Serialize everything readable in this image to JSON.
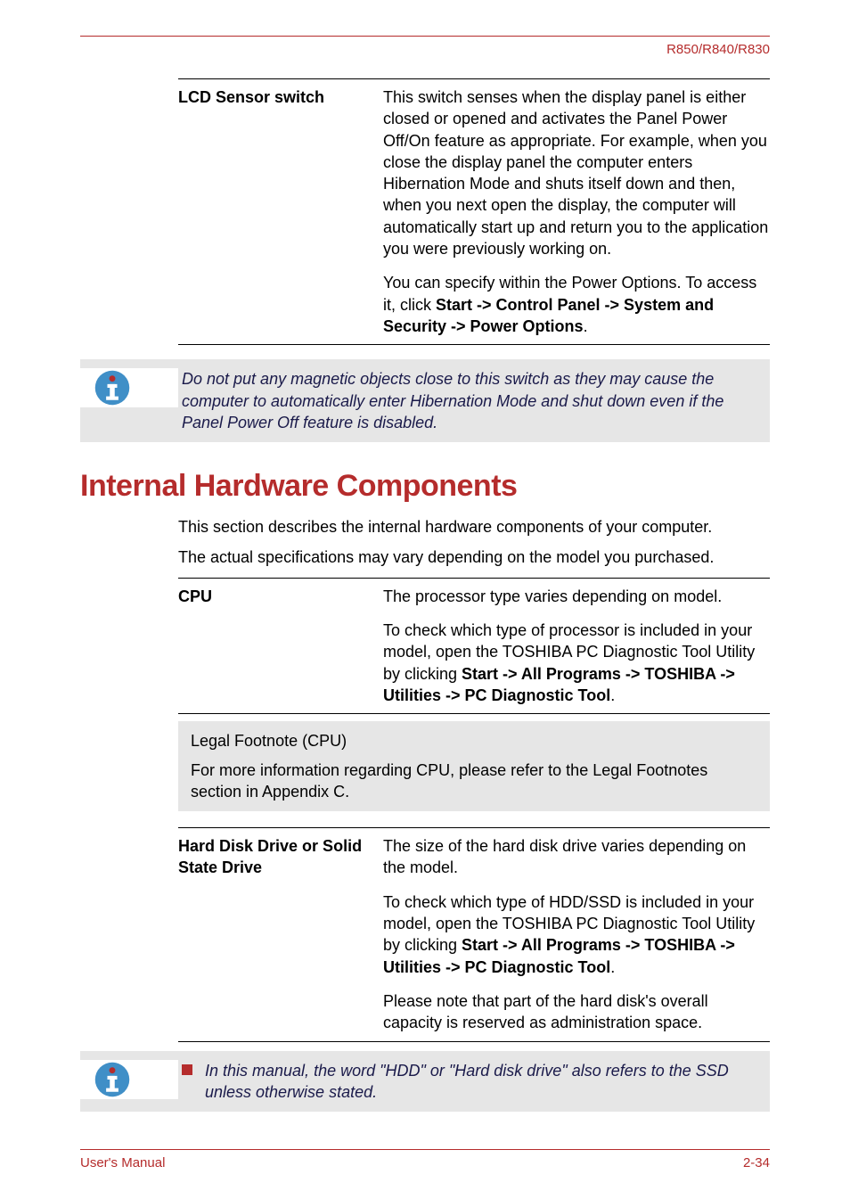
{
  "header": {
    "model": "R850/R840/R830"
  },
  "lcd_sensor": {
    "label": "LCD Sensor switch",
    "para1": "This switch senses when the display panel is either closed or opened and activates the Panel Power Off/On feature as appropriate. For example, when you close the display panel the computer enters Hibernation Mode and shuts itself down and then, when you next open the display, the computer will automatically start up and return you to the application you were previously working on.",
    "para2_pre": "You can specify within the Power Options. To access it, click ",
    "para2_b1": "Start -> Control Panel -> System and Security -> Power Options",
    "para2_post": "."
  },
  "note_magnetic": "Do not put any magnetic objects close to this switch as they may cause the computer to automatically enter Hibernation Mode and shut down even if the Panel Power Off feature is disabled.",
  "section": {
    "title": "Internal Hardware Components",
    "intro1": "This section describes the internal hardware components of your computer.",
    "intro2": "The actual specifications may vary depending on the model you purchased."
  },
  "cpu": {
    "label": "CPU",
    "para1": "The processor type varies depending on model.",
    "para2_pre": "To check which type of processor is included in your model, open the TOSHIBA PC Diagnostic Tool Utility by clicking ",
    "para2_b1": "Start -> All Programs -> TOSHIBA -> Utilities -> PC Diagnostic Tool",
    "para2_post": "."
  },
  "legal": {
    "line1": "Legal Footnote (CPU)",
    "line2": "For more information regarding CPU, please refer to the Legal Footnotes section in Appendix C."
  },
  "hdd": {
    "label": "Hard Disk Drive or Solid State Drive",
    "para1": "The size of the hard disk drive varies depending on the model.",
    "para2_pre": "To check which type of HDD/SSD is included in your model, open the TOSHIBA PC Diagnostic Tool Utility by clicking ",
    "para2_b1": "Start -> All Programs -> TOSHIBA -> Utilities -> PC Diagnostic Tool",
    "para2_post": ".",
    "para3": "Please note that part of the hard disk's overall capacity is reserved as administration space."
  },
  "note_hdd": "In this manual, the word \"HDD\" or \"Hard disk drive\" also refers to the SSD unless otherwise stated.",
  "footer": {
    "left": "User's Manual",
    "right": "2-34"
  }
}
